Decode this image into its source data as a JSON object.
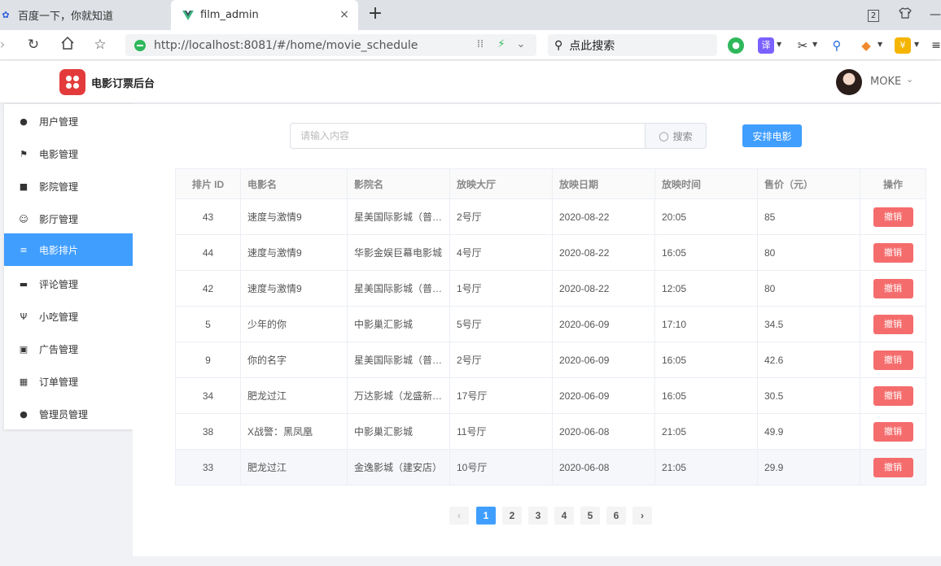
{
  "browser": {
    "tabs": [
      {
        "title": "百度一下，你就知道",
        "icon": "baidu-paw-icon"
      },
      {
        "title": "film_admin",
        "icon": "vue-logo-icon"
      }
    ],
    "tab_count_badge": "2",
    "url": "http://localhost:8081/#/home/movie_schedule",
    "search_placeholder": "点此搜索",
    "extensions": [
      "wechat-icon",
      "translate-icon",
      "scissors-icon",
      "search-magnify-icon",
      "gamepad-icon",
      "shield-icon"
    ],
    "translate_label": "译"
  },
  "app": {
    "title": "电影订票后台",
    "user": "MOKE"
  },
  "sidebar": {
    "items": [
      {
        "label": "用户管理",
        "icon": "user-icon"
      },
      {
        "label": "电影管理",
        "icon": "flag-icon"
      },
      {
        "label": "影院管理",
        "icon": "car-icon"
      },
      {
        "label": "影厅管理",
        "icon": "smile-icon"
      },
      {
        "label": "电影排片",
        "icon": "list-icon",
        "active": true
      },
      {
        "label": "评论管理",
        "icon": "comment-icon"
      },
      {
        "label": "小吃管理",
        "icon": "fork-knife-icon"
      },
      {
        "label": "广告管理",
        "icon": "picture-icon"
      },
      {
        "label": "订单管理",
        "icon": "film-strip-icon"
      },
      {
        "label": "管理员管理",
        "icon": "admin-icon"
      }
    ]
  },
  "toolbar": {
    "search_placeholder": "请输入内容",
    "search_label": "搜索",
    "arrange_label": "安排电影"
  },
  "table": {
    "headers": [
      "排片 ID",
      "电影名",
      "影院名",
      "放映大厅",
      "放映日期",
      "放映时间",
      "售价（元）",
      "操作"
    ],
    "action_label": "撤销",
    "rows": [
      [
        "43",
        "速度与激情9",
        "星美国际影城（普…",
        "2号厅",
        "2020-08-22",
        "20:05",
        "85"
      ],
      [
        "44",
        "速度与激情9",
        "华影金娱巨幕电影城",
        "4号厅",
        "2020-08-22",
        "16:05",
        "80"
      ],
      [
        "42",
        "速度与激情9",
        "星美国际影城（普…",
        "1号厅",
        "2020-08-22",
        "12:05",
        "80"
      ],
      [
        "5",
        "少年的你",
        "中影巢汇影城",
        "5号厅",
        "2020-06-09",
        "17:10",
        "34.5"
      ],
      [
        "9",
        "你的名字",
        "星美国际影城（普…",
        "2号厅",
        "2020-06-09",
        "16:05",
        "42.6"
      ],
      [
        "34",
        "肥龙过江",
        "万达影城（龙盛新…",
        "17号厅",
        "2020-06-09",
        "16:05",
        "30.5"
      ],
      [
        "38",
        "X战警：黑凤凰",
        "中影巢汇影城",
        "11号厅",
        "2020-06-08",
        "21:05",
        "49.9"
      ],
      [
        "33",
        "肥龙过江",
        "金逸影城（建安店）",
        "10号厅",
        "2020-06-08",
        "21:05",
        "29.9"
      ]
    ]
  },
  "pagination": {
    "pages": [
      "1",
      "2",
      "3",
      "4",
      "5",
      "6"
    ],
    "current": "1",
    "prev": "‹",
    "next": "›"
  },
  "colors": {
    "primary": "#409eff",
    "danger": "#f56c6c",
    "logo": "#e33b3b"
  }
}
